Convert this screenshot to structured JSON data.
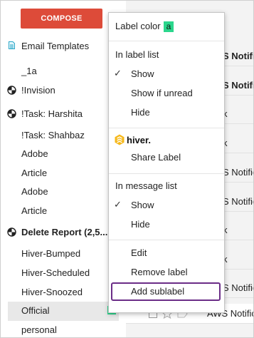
{
  "compose_label": "COMPOSE",
  "sidebar": {
    "items": [
      {
        "label": "Email Templates"
      },
      {
        "label": "_1a"
      },
      {
        "label": "!Invision"
      },
      {
        "label": "!Task: Harshita"
      },
      {
        "label": "!Task: Shahbaz"
      },
      {
        "label": "Adobe"
      },
      {
        "label": "Article"
      },
      {
        "label": "Adobe"
      },
      {
        "label": "Article"
      },
      {
        "label": "Delete Report (2,5..."
      },
      {
        "label": "Hiver-Bumped"
      },
      {
        "label": "Hiver-Scheduled"
      },
      {
        "label": "Hiver-Snoozed"
      },
      {
        "label": "Official"
      },
      {
        "label": "personal"
      }
    ]
  },
  "menu": {
    "label_color": "Label color",
    "color_badge": "a",
    "in_label_list": "In label list",
    "show": "Show",
    "show_if_unread": "Show if unread",
    "hide": "Hide",
    "brand": "hiver.",
    "share_label": "Share Label",
    "in_message_list": "In message list",
    "show2": "Show",
    "hide2": "Hide",
    "edit": "Edit",
    "remove_label": "Remove label",
    "add_sublabel": "Add sublabel"
  },
  "email_list": {
    "rows": [
      {
        "text": "S Notifi"
      },
      {
        "text": "S Notifi"
      },
      {
        "text": "k"
      },
      {
        "text": "k"
      },
      {
        "text": "S Notific"
      },
      {
        "text": "S Notific"
      },
      {
        "text": "k"
      },
      {
        "text": "k"
      },
      {
        "text": "S Notific"
      },
      {
        "text": "AWS Notific"
      }
    ]
  },
  "colors": {
    "accent": "#dd4b39",
    "label_green": "#2bd68c",
    "highlight": "#6b2d87"
  }
}
